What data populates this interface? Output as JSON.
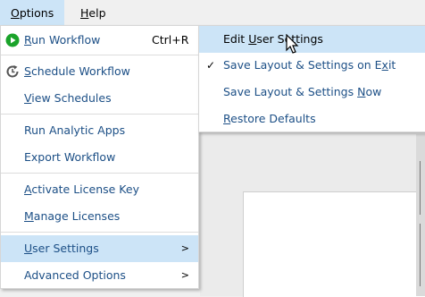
{
  "menubar": {
    "options": {
      "pre": "",
      "key": "O",
      "post": "ptions"
    },
    "help": {
      "pre": "",
      "key": "H",
      "post": "elp"
    }
  },
  "main_menu": {
    "run_workflow": {
      "pre": "",
      "key": "R",
      "post": "un Workflow",
      "shortcut": "Ctrl+R",
      "icon": "play-circle-icon"
    },
    "schedule_workflow": {
      "pre": "",
      "key": "S",
      "post": "chedule Workflow",
      "icon": "schedule-clock-icon"
    },
    "view_schedules": {
      "pre": "",
      "key": "V",
      "post": "iew Schedules"
    },
    "run_analytic_apps": {
      "label": "Run Analytic Apps"
    },
    "export_workflow": {
      "label": "Export Workflow"
    },
    "activate_license_key": {
      "pre": "",
      "key": "A",
      "post": "ctivate License Key"
    },
    "manage_licenses": {
      "pre": "",
      "key": "M",
      "post": "anage Licenses"
    },
    "user_settings": {
      "pre": "",
      "key": "U",
      "post": "ser Settings",
      "arrow": ">"
    },
    "advanced_options": {
      "label": "Advanced Options",
      "arrow": ">"
    }
  },
  "sub_menu": {
    "edit_user_settings": {
      "pre": "Edit ",
      "key": "U",
      "post": "ser Settings"
    },
    "save_layout_on_exit": {
      "pre": "Save Layout & Settings on E",
      "key": "x",
      "post": "it",
      "check": "✓"
    },
    "save_layout_now": {
      "pre": "Save Layout & Settings ",
      "key": "N",
      "post": "ow"
    },
    "restore_defaults": {
      "pre": "",
      "key": "R",
      "post": "estore Defaults"
    }
  },
  "colors": {
    "menu_text": "#1c4f86",
    "highlight": "#cce4f7",
    "play_green": "#1aa32a"
  }
}
